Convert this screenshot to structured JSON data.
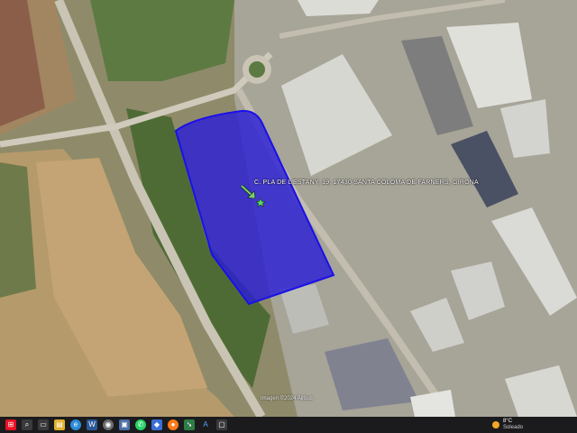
{
  "map": {
    "place_label": "C. PLA DE L'ESTANY, 19, 17430 SANTA COLOMA DE FARNERS, GIRONA",
    "attribution": "Imagen ©2024 Airbus",
    "colors": {
      "parcel_fill": "#2b1fd6",
      "parcel_stroke": "#1a10e8",
      "pin": "#5fd16b"
    }
  },
  "taskbar": {
    "icons": [
      "start-icon",
      "search-icon",
      "task-view-icon",
      "file-explorer-icon",
      "edge-icon",
      "word-icon",
      "app-icon",
      "save-icon",
      "whatsapp-icon",
      "photos-icon",
      "firefox-icon",
      "pointer-icon",
      "text-icon",
      "window-icon"
    ],
    "weather": {
      "temp": "8°C",
      "condition": "Soleado"
    }
  }
}
